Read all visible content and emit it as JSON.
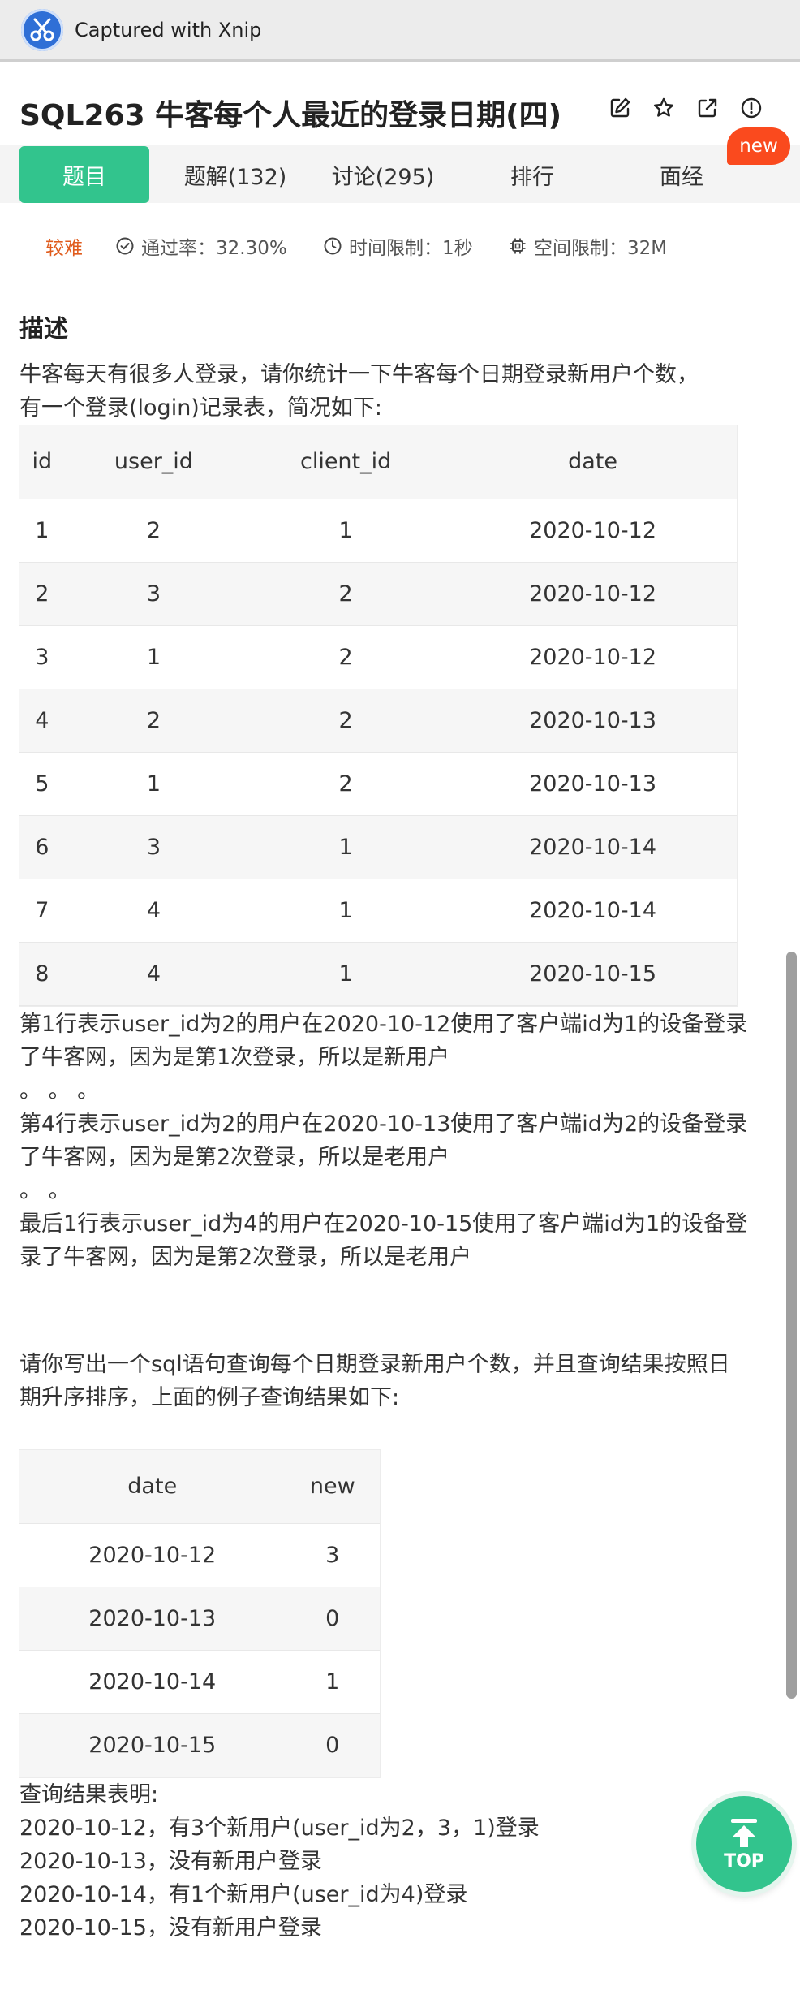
{
  "capture_bar": {
    "title": "Captured with Xnip",
    "logo_icon": "xnip-scissors-icon"
  },
  "problem": {
    "title": "SQL263  牛客每个人最近的登录日期(四)",
    "icons": [
      "edit-icon",
      "star-icon",
      "share-icon",
      "info-icon"
    ]
  },
  "tabs": [
    {
      "label": "题目",
      "active": true
    },
    {
      "label": "题解(132)",
      "active": false
    },
    {
      "label": "讨论(295)",
      "active": false
    },
    {
      "label": "排行",
      "active": false
    },
    {
      "label": "面经",
      "active": false
    }
  ],
  "new_badge": "new",
  "meta": {
    "difficulty": "较难",
    "pass_rate": "通过率：32.30%",
    "time_limit": "时间限制：1秒",
    "space_limit": "空间限制：32M"
  },
  "description": {
    "heading": "描述",
    "intro_line1": "牛客每天有很多人登录，请你统计一下牛客每个日期登录新用户个数，",
    "intro_line2": "有一个登录(login)记录表，简况如下:",
    "login_table": {
      "columns": [
        "id",
        "user_id",
        "client_id",
        "date"
      ],
      "rows": [
        [
          "1",
          "2",
          "1",
          "2020-10-12"
        ],
        [
          "2",
          "3",
          "2",
          "2020-10-12"
        ],
        [
          "3",
          "1",
          "2",
          "2020-10-12"
        ],
        [
          "4",
          "2",
          "2",
          "2020-10-13"
        ],
        [
          "5",
          "1",
          "2",
          "2020-10-13"
        ],
        [
          "6",
          "3",
          "1",
          "2020-10-14"
        ],
        [
          "7",
          "4",
          "1",
          "2020-10-14"
        ],
        [
          "8",
          "4",
          "1",
          "2020-10-15"
        ]
      ]
    },
    "note1_line1": "第1行表示user_id为2的用户在2020-10-12使用了客户端id为1的设备登录",
    "note1_line2": "了牛客网，因为是第1次登录，所以是新用户",
    "dots1": "。 。 。",
    "note2_line1": "第4行表示user_id为2的用户在2020-10-13使用了客户端id为2的设备登录",
    "note2_line2": "了牛客网，因为是第2次登录，所以是老用户",
    "dots2": "。 。",
    "note3_line1": "最后1行表示user_id为4的用户在2020-10-15使用了客户端id为1的设备登",
    "note3_line2": "录了牛客网，因为是第2次登录，所以是老用户",
    "task_line1": "请你写出一个sql语句查询每个日期登录新用户个数，并且查询结果按照日",
    "task_line2": "期升序排序，上面的例子查询结果如下:",
    "result_table": {
      "columns": [
        "date",
        "new"
      ],
      "rows": [
        [
          "2020-10-12",
          "3"
        ],
        [
          "2020-10-13",
          "0"
        ],
        [
          "2020-10-14",
          "1"
        ],
        [
          "2020-10-15",
          "0"
        ]
      ]
    },
    "result_heading": "查询结果表明:",
    "result_lines": [
      "2020-10-12，有3个新用户(user_id为2，3，1)登录",
      "2020-10-13，没有新用户登录",
      "2020-10-14，有1个新用户(user_id为4)登录",
      "2020-10-15，没有新用户登录"
    ]
  },
  "top_button": {
    "label": "TOP",
    "icon": "arrow-up-to-top-icon"
  },
  "colors": {
    "accent": "#32c48d",
    "difficulty": "#e05b1c",
    "badge": "#fa4a1e"
  }
}
